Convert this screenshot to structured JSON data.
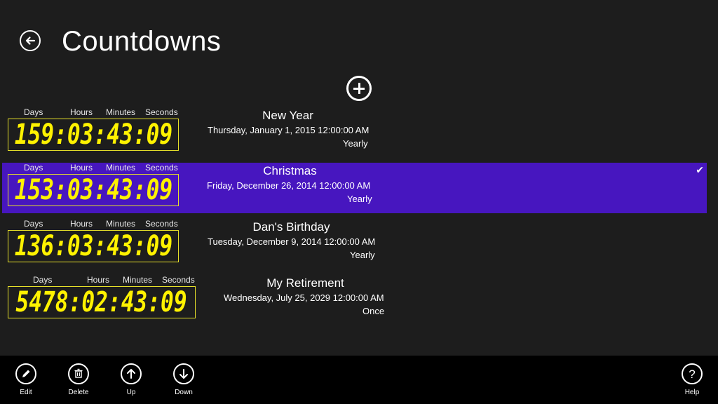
{
  "header": {
    "title": "Countdowns",
    "back_icon": "back-arrow-icon",
    "add_icon": "add-circle-icon"
  },
  "unit_labels": {
    "days": "Days",
    "hours": "Hours",
    "minutes": "Minutes",
    "seconds": "Seconds"
  },
  "countdowns": [
    {
      "name": "New Year",
      "date": "Thursday, January 1, 2015 12:00:00 AM",
      "repeat": "Yearly",
      "timer": "159:03:43:09",
      "selected": false
    },
    {
      "name": "Christmas",
      "date": "Friday, December 26, 2014 12:00:00 AM",
      "repeat": "Yearly",
      "timer": "153:03:43:09",
      "selected": true
    },
    {
      "name": "Dan's Birthday",
      "date": "Tuesday, December 9, 2014 12:00:00 AM",
      "repeat": "Yearly",
      "timer": "136:03:43:09",
      "selected": false
    },
    {
      "name": "My Retirement",
      "date": "Wednesday, July 25, 2029 12:00:00 AM",
      "repeat": "Once",
      "timer": "5478:02:43:09",
      "selected": false
    }
  ],
  "appbar": {
    "edit": "Edit",
    "delete": "Delete",
    "up": "Up",
    "down": "Down",
    "help": "Help"
  },
  "colors": {
    "background": "#1d1d1d",
    "selection": "#4716bf",
    "lcd_digits": "#fff200",
    "lcd_border": "#e6e02a",
    "appbar": "#000000"
  }
}
